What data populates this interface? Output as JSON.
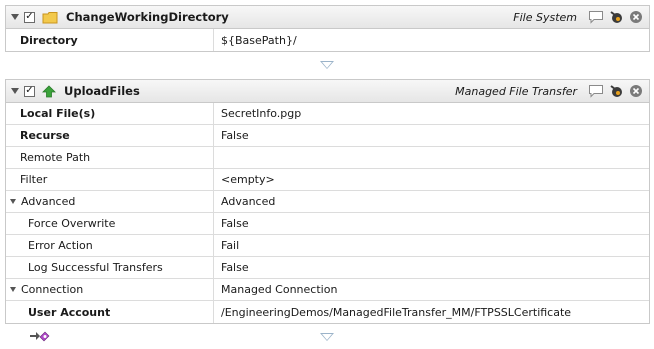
{
  "actions": [
    {
      "name": "ChangeWorkingDirectory",
      "enabled": true,
      "icon": "folder-icon",
      "category": "File System",
      "rows": [
        {
          "label": "Directory",
          "value": "${BasePath}/"
        }
      ]
    },
    {
      "name": "UploadFiles",
      "enabled": true,
      "icon": "upload-arrow-icon",
      "category": "Managed File Transfer",
      "rows": [
        {
          "label": "Local File(s)",
          "value": "SecretInfo.pgp"
        },
        {
          "label": "Recurse",
          "value": "False"
        },
        {
          "label": "Remote Path",
          "value": ""
        },
        {
          "label": "Filter",
          "value": "<empty>"
        },
        {
          "label": "Advanced",
          "value": "Advanced"
        },
        {
          "label": "Force Overwrite",
          "value": "False"
        },
        {
          "label": "Error Action",
          "value": "Fail"
        },
        {
          "label": "Log Successful Transfers",
          "value": "False"
        },
        {
          "label": "Connection",
          "value": "Managed Connection"
        },
        {
          "label": "User Account",
          "value": "/EngineeringDemos/ManagedFileTransfer_MM/FTPSSLCertificate"
        }
      ]
    }
  ],
  "colors": {
    "header_bg": "#eeeeee",
    "border": "#c9c9c9",
    "connector": "#9bb3c9",
    "upload_green": "#3aa33a",
    "folder_yellow": "#f2c94c",
    "close_gray": "#7a7a7a"
  }
}
